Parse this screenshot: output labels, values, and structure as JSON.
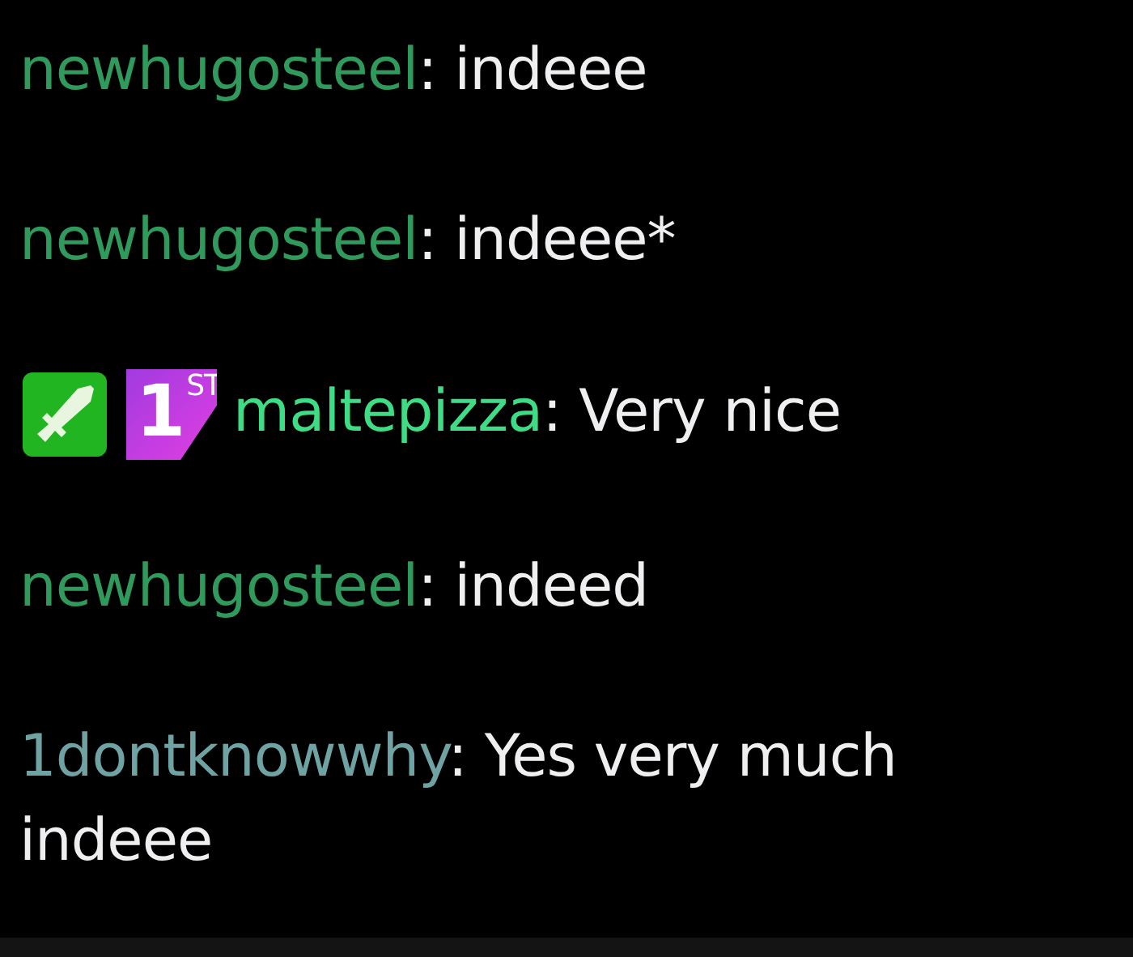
{
  "messages": [
    {
      "username": "newhugosteel",
      "color": "#2f9a5c",
      "text": ": indeee"
    },
    {
      "username": "newhugosteel",
      "color": "#2f9a5c",
      "text": ": indeee*"
    },
    {
      "badges": [
        {
          "kind": "sword"
        },
        {
          "kind": "first",
          "number": "1",
          "suffix": "ST"
        }
      ],
      "username": "maltepizza",
      "color": "#3fdc86",
      "text": ": Very nice"
    },
    {
      "username": "newhugosteel",
      "color": "#2f9a5c",
      "text": ": indeed"
    },
    {
      "username": "1dontknowwhy",
      "color": "#6fa3a3",
      "text": ": Yes very much indeee"
    }
  ]
}
